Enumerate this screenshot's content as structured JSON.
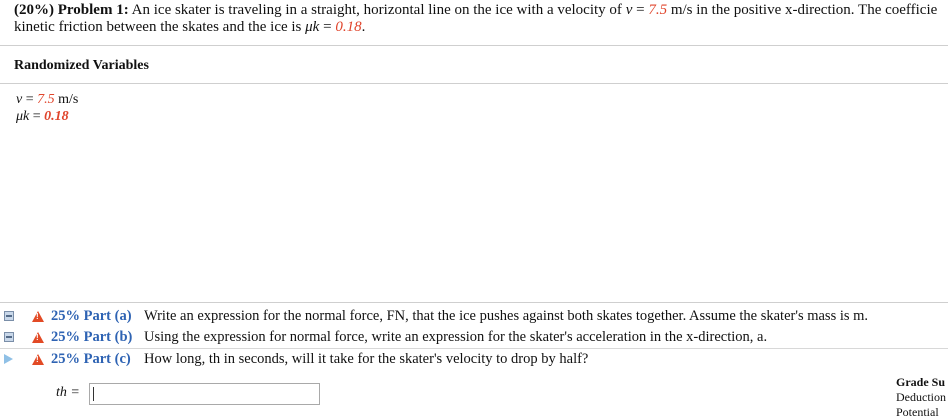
{
  "problem": {
    "percent": "(20%)",
    "number": "Problem 1:",
    "text_1": "An ice skater is traveling in a straight, horizontal line on the ice with a velocity of",
    "v_symbol": "v",
    "equals": " = ",
    "v_value": "7.5",
    "v_unit": " m/s in the positive x-direction. The coefficie",
    "text_2": "kinetic friction between the skates and the ice is",
    "mu_symbol": "μk",
    "mu_value": "0.18",
    "period": "."
  },
  "randomized_variables": {
    "title": "Randomized Variables",
    "v_line_symbol": "v",
    "v_line_value": "7.5",
    "v_line_unit": " m/s",
    "mu_line_symbol": "μk",
    "mu_line_value": "0.18"
  },
  "parts": [
    {
      "label": "25% Part (a)",
      "text": "Write an expression for the normal force, FN, that the ice pushes against both skates together. Assume the skater's mass is m."
    },
    {
      "label": "25% Part (b)",
      "text": "Using the expression for normal force, write an expression for the skater's acceleration in the x-direction, a."
    },
    {
      "label": "25% Part (c)",
      "text": "How long, th in seconds, will it take for the skater's velocity to drop by half?"
    }
  ],
  "answer": {
    "label": "th =",
    "value": ""
  },
  "grade_panel": {
    "title": "Grade Su",
    "line1": "Deduction",
    "line2": "Potential"
  },
  "colors": {
    "variable_red": "#e0452c",
    "part_blue": "#2e63b3",
    "warning_red": "#e24a25"
  },
  "icons": {
    "collapse": "minus-box-icon",
    "expand": "play-triangle-icon",
    "warning": "warning-triangle-icon"
  }
}
